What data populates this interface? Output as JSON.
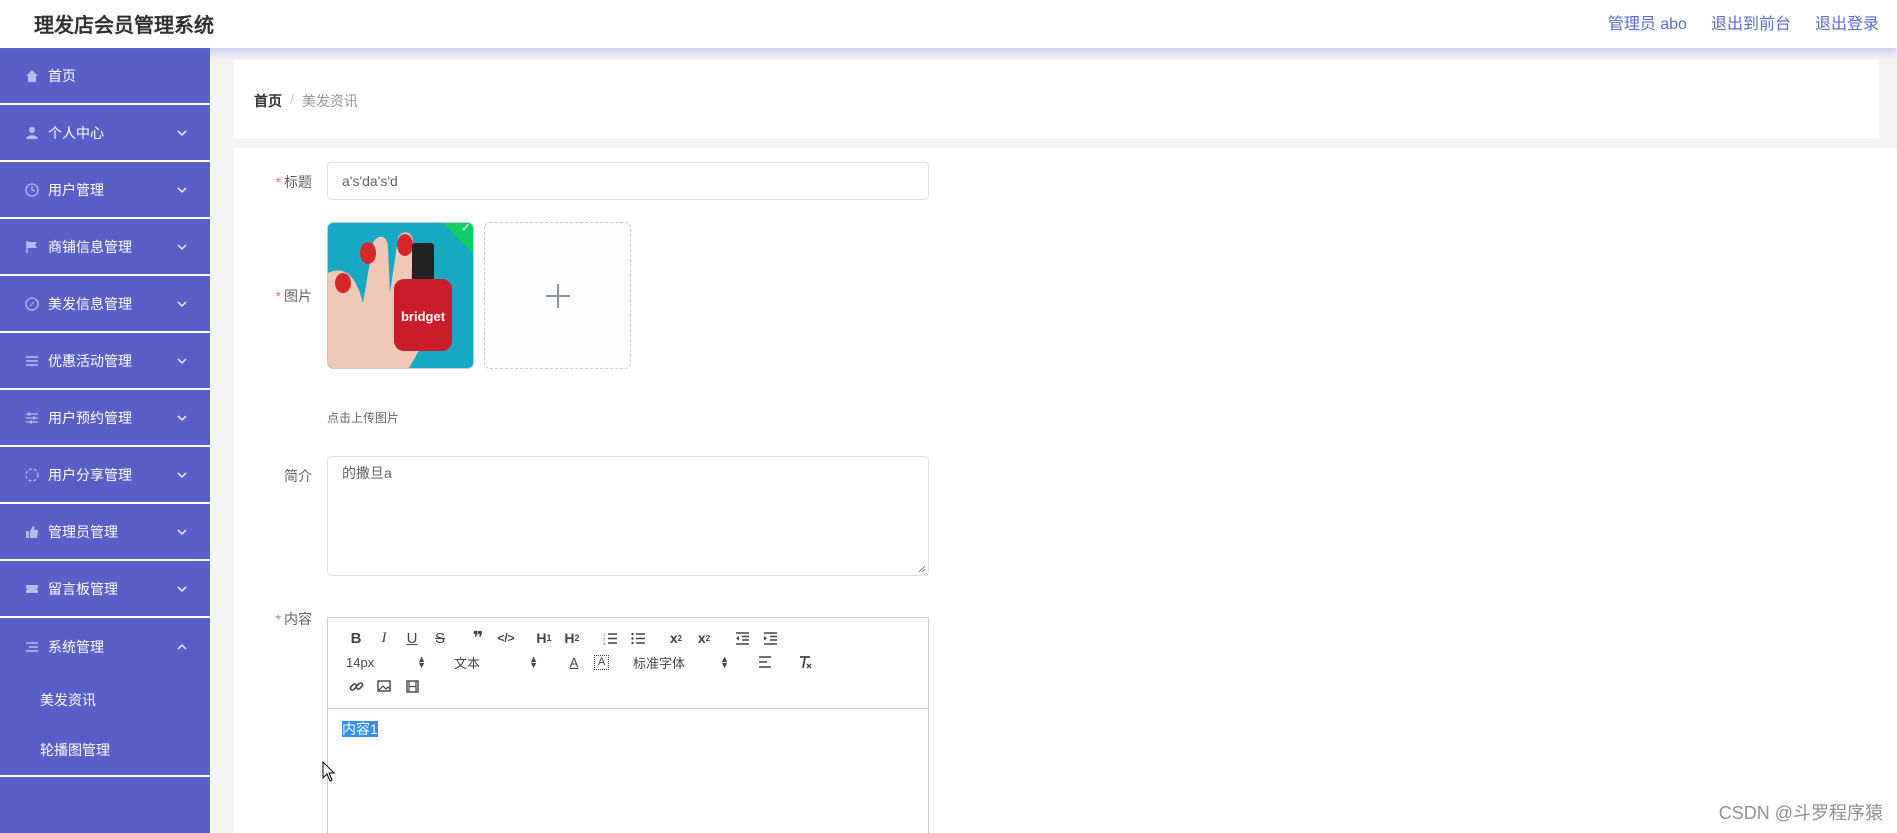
{
  "app": {
    "title": "理发店会员管理系统"
  },
  "header": {
    "user_label": "管理员 abo",
    "front_label": "退出到前台",
    "logout_label": "退出登录"
  },
  "sidebar": {
    "items": [
      {
        "label": "首页",
        "icon": "home-icon"
      },
      {
        "label": "个人中心",
        "icon": "user-icon"
      },
      {
        "label": "用户管理",
        "icon": "clock-icon"
      },
      {
        "label": "商铺信息管理",
        "icon": "flag-icon"
      },
      {
        "label": "美发信息管理",
        "icon": "compass-icon"
      },
      {
        "label": "优惠活动管理",
        "icon": "menu-icon"
      },
      {
        "label": "用户预约管理",
        "icon": "sliders-icon"
      },
      {
        "label": "用户分享管理",
        "icon": "circle-icon"
      },
      {
        "label": "管理员管理",
        "icon": "thumb-icon"
      },
      {
        "label": "留言板管理",
        "icon": "ticket-icon"
      },
      {
        "label": "系统管理",
        "icon": "list-icon"
      }
    ],
    "sub_items": [
      {
        "label": "美发资讯"
      },
      {
        "label": "轮播图管理"
      }
    ]
  },
  "breadcrumb": {
    "home": "首页",
    "separator": "/",
    "current": "美发资讯"
  },
  "form": {
    "title_label": "标题",
    "title_value": "a's'da's'd",
    "image_label": "图片",
    "upload_hint": "点击上传图片",
    "intro_label": "简介",
    "intro_value": "的撒旦a",
    "content_label": "内容",
    "required_mark": "*"
  },
  "editor": {
    "font_size": "14px",
    "paragraph": "文本",
    "font_family": "标准字体",
    "content": "内容1"
  },
  "photo": {
    "brand_text": "bridget"
  },
  "watermark": "CSDN @斗罗程序猿",
  "colors": {
    "sidebar": "#5a5fc8",
    "accent": "#5a6ad6",
    "required": "#f56c6c",
    "success": "#13ce66"
  }
}
